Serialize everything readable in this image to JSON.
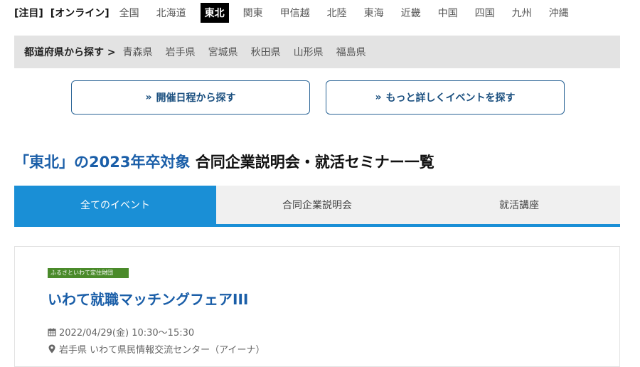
{
  "region_nav": {
    "featured": "[注目]",
    "online": "[オンライン]",
    "regions": [
      "全国",
      "北海道",
      "東北",
      "関東",
      "甲信越",
      "北陸",
      "東海",
      "近畿",
      "中国",
      "四国",
      "九州",
      "沖縄"
    ],
    "active_region": "東北"
  },
  "prefecture_bar": {
    "label": "都道府県から探す",
    "items": [
      "青森県",
      "岩手県",
      "宮城県",
      "秋田県",
      "山形県",
      "福島県"
    ]
  },
  "search_buttons": {
    "by_date": "開催日程から探す",
    "detailed": "もっと詳しくイベントを探す"
  },
  "page_title": {
    "highlight": "「東北」の2023年卒対象",
    "rest": "合同企業説明会・就活セミナー一覧"
  },
  "tabs": [
    "全てのイベント",
    "合同企業説明会",
    "就活講座"
  ],
  "active_tab": "全てのイベント",
  "event": {
    "organizer_logo_text": "ふるさといわて定住財団",
    "title": "いわて就職マッチングフェアIII",
    "date": "2022/04/29(金) 10:30〜15:30",
    "venue": "岩手県 いわて県民情報交流センター（アイーナ）"
  },
  "colors": {
    "accent_blue": "#1a8fd6",
    "title_blue": "#1a5ea8",
    "active_region_bg": "#000000",
    "pref_bar_bg": "#e3e3e3"
  }
}
